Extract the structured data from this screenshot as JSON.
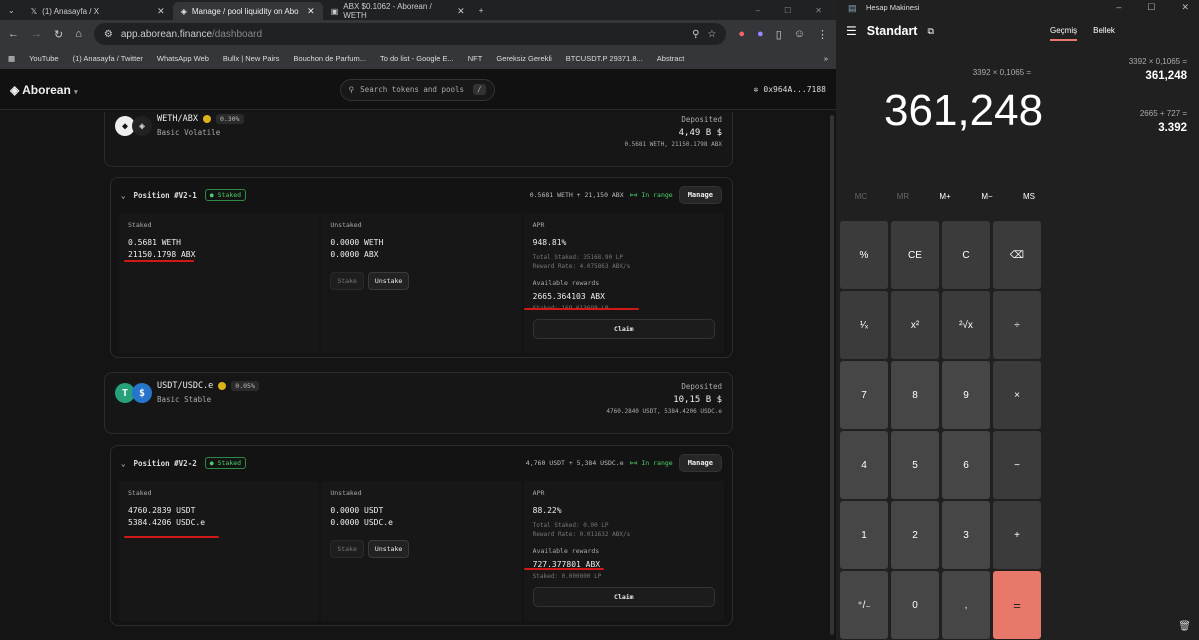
{
  "browser": {
    "tabs": [
      {
        "label": "(1) Anasayfa / X"
      },
      {
        "label": "Manage / pool liquidity on Abo"
      },
      {
        "label": "ABX $0.1062 - Aborean / WETH"
      }
    ],
    "url_host": "app.aborean.finance",
    "url_path": "/dashboard",
    "bookmarks": [
      "YouTube",
      "(1) Anasayfa / Twitter",
      "WhatsApp Web",
      "Bullx | New Pairs",
      "Bouchon de Parfum...",
      "To do list - Google E...",
      "NFT",
      "Gereksiz Gerekli",
      "BTCUSDT.P 29371.8...",
      "Abstract"
    ]
  },
  "app": {
    "logo": "Aborean",
    "search_placeholder": "Search tokens and pools",
    "search_shortcut": "/",
    "wallet": "0x964A...7188"
  },
  "pools": [
    {
      "name": "WETH/ABX",
      "fee": "0.30%",
      "type": "Basic Volatile",
      "deposited_label": "Deposited",
      "deposited_value": "4,49 B $",
      "deposited_amounts": "0.5681 WETH, 21150.1798 ABX",
      "position": {
        "title": "Position #V2-1",
        "badge": "Staked",
        "summary": "0.5681 WETH + 21,150 ABX",
        "range": "In range",
        "manage": "Manage",
        "staked_label": "Staked",
        "staked": [
          "0.5681 WETH",
          "21150.1798 ABX"
        ],
        "unstaked_label": "Unstaked",
        "unstaked": [
          "0.0000 WETH",
          "0.0000 ABX"
        ],
        "stake_btn": "Stake",
        "unstake_btn": "Unstake",
        "apr_label": "APR",
        "apr": "948.81%",
        "total_staked": "Total Staked: 35168.90 LP",
        "reward_rate": "Reward Rate: 4.075863 ABX/s",
        "rewards_label": "Available rewards",
        "rewards": "2665.364103 ABX",
        "staked_lp": "Staked: 169.613698 LP",
        "claim": "Claim"
      }
    },
    {
      "name": "USDT/USDC.e",
      "fee": "0.05%",
      "type": "Basic Stable",
      "deposited_label": "Deposited",
      "deposited_value": "10,15 B $",
      "deposited_amounts": "4760.2840 USDT, 5384.4206 USDC.e",
      "position": {
        "title": "Position #V2-2",
        "badge": "Staked",
        "summary": "4,760 USDT + 5,384 USDC.e",
        "range": "In range",
        "manage": "Manage",
        "staked_label": "Staked",
        "staked": [
          "4760.2839 USDT",
          "5384.4206 USDC.e"
        ],
        "unstaked_label": "Unstaked",
        "unstaked": [
          "0.0000 USDT",
          "0.0000 USDC.e"
        ],
        "stake_btn": "Stake",
        "unstake_btn": "Unstake",
        "apr_label": "APR",
        "apr": "88.22%",
        "total_staked": "Total Staked: 0.00 LP",
        "reward_rate": "Reward Rate: 0.011632 ABX/s",
        "rewards_label": "Available rewards",
        "rewards": "727.377801 ABX",
        "staked_lp": "Staked: 0.000000 LP",
        "claim": "Claim"
      }
    }
  ],
  "calculator": {
    "title": "Hesap Makinesi",
    "mode": "Standart",
    "tab_history": "Geçmiş",
    "tab_memory": "Bellek",
    "expression": "3392 × 0,1065 =",
    "display": "361,248",
    "history": [
      {
        "expr": "3392  ×  0,1065 =",
        "result": "361,248"
      },
      {
        "expr": "2665  +  727 =",
        "result": "3.392"
      }
    ],
    "memory_keys": [
      "MC",
      "MR",
      "M+",
      "M−",
      "MS"
    ],
    "keys": [
      "%",
      "CE",
      "C",
      "⌫",
      "¹⁄ₓ",
      "x²",
      "²√x",
      "÷",
      "7",
      "8",
      "9",
      "×",
      "4",
      "5",
      "6",
      "−",
      "1",
      "2",
      "3",
      "+",
      "⁺/₋",
      "0",
      ",",
      "="
    ],
    "accent": "#e8796a"
  }
}
